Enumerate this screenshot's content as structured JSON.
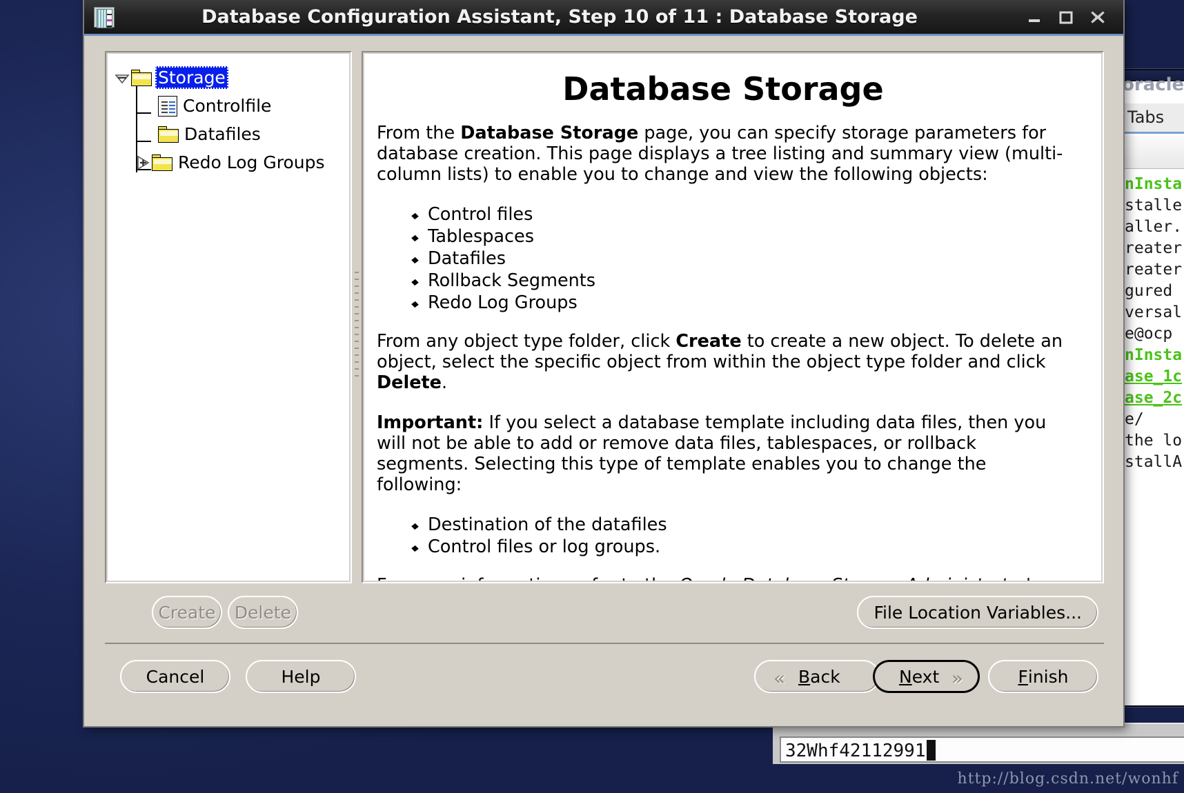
{
  "window": {
    "title": "Database Configuration Assistant, Step 10 of 11 : Database Storage",
    "icon": "database-assistant-icon",
    "minimize_label": "—",
    "maximize_label": "□",
    "close_label": "✕"
  },
  "tree": {
    "root": {
      "label": "Storage",
      "icon": "folder-icon",
      "toggle": "collapse-toggle-icon",
      "selected": true
    },
    "children": [
      {
        "label": "Controlfile",
        "icon": "controlfile-document-icon",
        "toggle": "none"
      },
      {
        "label": "Datafiles",
        "icon": "folder-icon",
        "toggle": "none"
      },
      {
        "label": "Redo Log Groups",
        "icon": "folder-icon",
        "toggle": "expand-toggle-icon"
      }
    ]
  },
  "doc": {
    "heading": "Database Storage",
    "p1_a": "From the ",
    "p1_b": "Database Storage",
    "p1_c": " page, you can specify storage parameters for database creation. This page displays a tree listing and summary view (multi-column lists) to enable you to change and view the following objects:",
    "list1": [
      "Control files",
      "Tablespaces",
      "Datafiles",
      "Rollback Segments",
      "Redo Log Groups"
    ],
    "p2_a": "From any object type folder, click ",
    "p2_b": "Create",
    "p2_c": " to create a new object. To delete an object, select the specific object from within the object type folder and click ",
    "p2_d": "Delete",
    "p2_e": ".",
    "p3_a": "Important:",
    "p3_b": " If you select a database template including data files, then you will not be able to add or remove data files, tablespaces, or rollback segments. Selecting this type of template enables you to change the following:",
    "list2": [
      "Destination of the datafiles",
      "Control files or log groups."
    ],
    "p4_a": "For more information, refer to the ",
    "p4_b": "Oracle Database Storage Administrator's Guide",
    "p4_c": "."
  },
  "object_buttons": {
    "create": "Create",
    "delete": "Delete",
    "file_location_variables": "File Location Variables..."
  },
  "nav": {
    "cancel": "Cancel",
    "help": "Help",
    "back_mn": "B",
    "back_rest": "ack",
    "back_chevron": "«",
    "next_mn": "N",
    "next_rest": "ext",
    "next_chevron": "»",
    "finish_mn": "F",
    "finish_rest": "inish"
  },
  "terminal": {
    "title": "oracle@",
    "menu_tabs": "Tabs",
    "lines": [
      "",
      "",
      "nInsta",
      "staller",
      "aller..",
      "",
      "reater",
      "reater",
      "gured",
      "",
      "versal",
      "e@ocp",
      "nInsta",
      "",
      "",
      "ase_1c",
      "ase_2c",
      "e/",
      "",
      "",
      "the lo",
      "stallA"
    ]
  },
  "bottom_field": {
    "value": "32Whf42112991"
  },
  "watermark": "http://blog.csdn.net/wonhf",
  "colors": {
    "dialog_face": "#d4d0c8",
    "selection_blue": "#0820ea",
    "titlebar_accent": "#6e90c4",
    "terminal_green": "#4cc21a",
    "desktop_blue": "#1d2a5c"
  }
}
